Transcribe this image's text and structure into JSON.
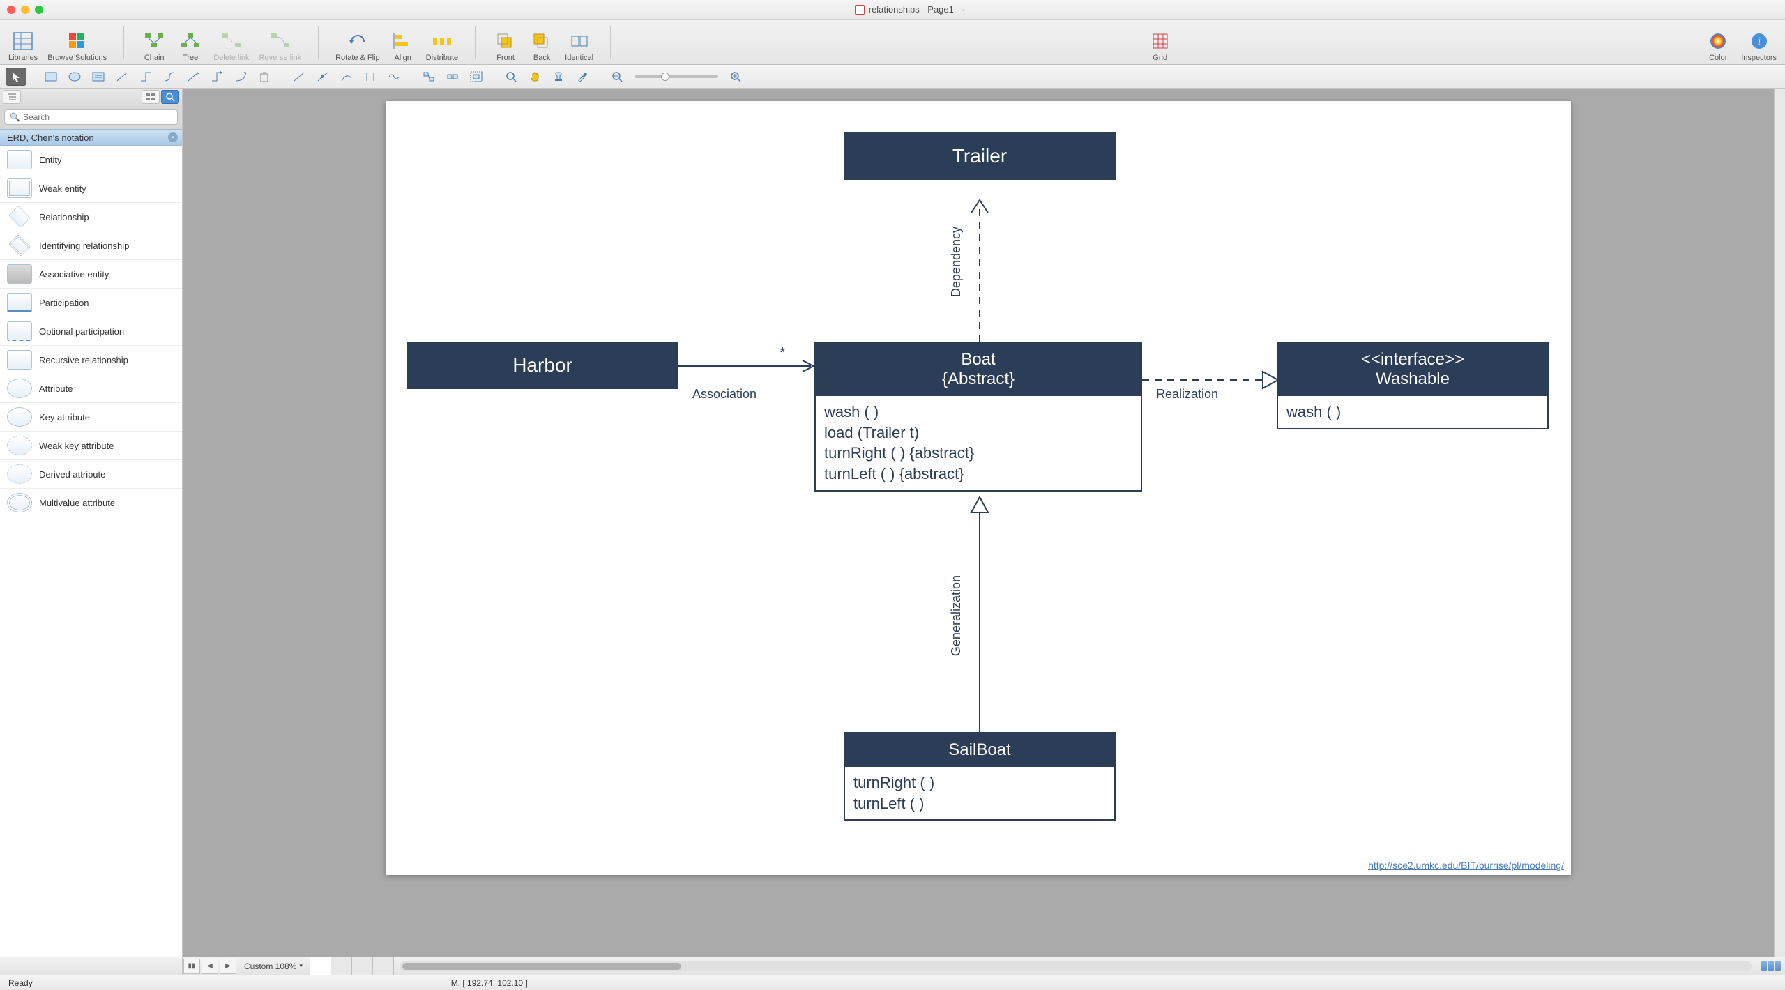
{
  "window": {
    "title": "relationships - Page1"
  },
  "toolbar": {
    "libraries": "Libraries",
    "browse_solutions": "Browse Solutions",
    "chain": "Chain",
    "tree": "Tree",
    "delete_link": "Delete link",
    "reverse_link": "Reverse link",
    "rotate_flip": "Rotate & Flip",
    "align": "Align",
    "distribute": "Distribute",
    "front": "Front",
    "back": "Back",
    "identical": "Identical",
    "grid": "Grid",
    "color": "Color",
    "inspectors": "Inspectors"
  },
  "sidebar": {
    "search_placeholder": "Search",
    "section_title": "ERD, Chen's notation",
    "items": [
      {
        "label": "Entity",
        "shape": "rect"
      },
      {
        "label": "Weak entity",
        "shape": "rect"
      },
      {
        "label": "Relationship",
        "shape": "diamond"
      },
      {
        "label": "Identifying relationship",
        "shape": "diamond"
      },
      {
        "label": "Associative entity",
        "shape": "diamond"
      },
      {
        "label": "Participation",
        "shape": "rect"
      },
      {
        "label": "Optional participation",
        "shape": "rect"
      },
      {
        "label": "Recursive relationship",
        "shape": "rect"
      },
      {
        "label": "Attribute",
        "shape": "ellipse"
      },
      {
        "label": "Key attribute",
        "shape": "ellipse"
      },
      {
        "label": "Weak key attribute",
        "shape": "ellipse"
      },
      {
        "label": "Derived attribute",
        "shape": "ellipse"
      },
      {
        "label": "Multivalue attribute",
        "shape": "ellipse"
      }
    ]
  },
  "diagram": {
    "trailer": "Trailer",
    "harbor": "Harbor",
    "boat_title": "Boat",
    "boat_subtitle": "{Abstract}",
    "boat_ops": [
      "wash ( )",
      "load (Trailer t)",
      "turnRight ( ) {abstract}",
      "turnLeft ( ) {abstract}"
    ],
    "interface_stereo": "<<interface>>",
    "interface_name": "Washable",
    "interface_ops": [
      "wash ( )"
    ],
    "sailboat": "SailBoat",
    "sailboat_ops": [
      "turnRight ( )",
      "turnLeft ( )"
    ],
    "lbl_association": "Association",
    "lbl_star": "*",
    "lbl_dependency": "Dependency",
    "lbl_realization": "Realization",
    "lbl_generalization": "Generalization",
    "url": "http://sce2.umkc.edu/BIT/burrise/pl/modeling/"
  },
  "pagebar": {
    "zoom": "Custom 108%"
  },
  "status": {
    "ready": "Ready",
    "mouse": "M: [ 192.74, 102.10 ]"
  }
}
